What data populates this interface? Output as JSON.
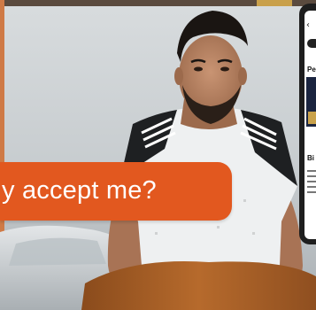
{
  "speech_bubble": {
    "text": "y accept me?"
  },
  "phone": {
    "back_glyph": "‹",
    "text_1": "Pe",
    "text_2": "Bi"
  },
  "colors": {
    "bubble": "#e2581f",
    "bubble_text": "#ffffff",
    "background": "#cfd4d6",
    "phone_frame": "#1e1e1e"
  },
  "icons": {
    "back": "chevron-left-icon"
  }
}
